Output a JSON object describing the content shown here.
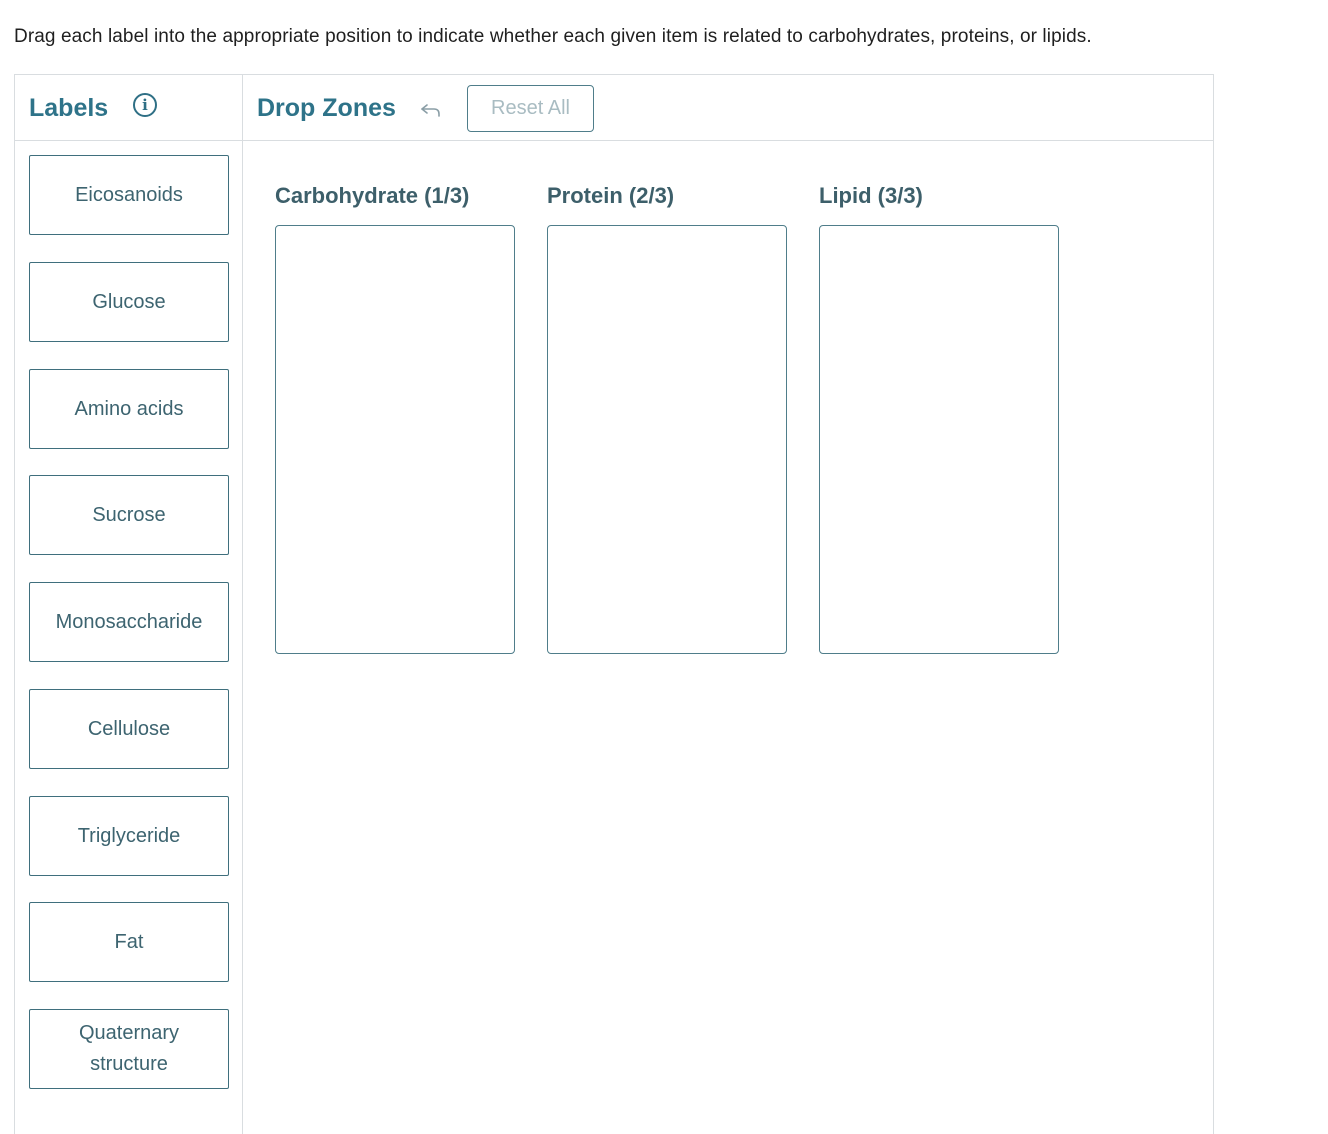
{
  "instructions": "Drag each label into the appropriate position to indicate whether each given item is related to carbohydrates, proteins, or lipids.",
  "labels_panel": {
    "title": "Labels",
    "info_icon": "info-icon",
    "items": [
      {
        "label": "Eicosanoids"
      },
      {
        "label": "Glucose"
      },
      {
        "label": "Amino acids"
      },
      {
        "label": "Sucrose"
      },
      {
        "label": "Monosaccharide"
      },
      {
        "label": "Cellulose"
      },
      {
        "label": "Triglyceride"
      },
      {
        "label": "Fat"
      },
      {
        "label": "Quaternary structure"
      }
    ]
  },
  "drop_panel": {
    "title": "Drop Zones",
    "undo_icon": "undo-arrow-icon",
    "reset_label": "Reset All",
    "zones": [
      {
        "title": "Carbohydrate (1/3)"
      },
      {
        "title": "Protein (2/3)"
      },
      {
        "title": "Lipid (3/3)"
      }
    ]
  },
  "colors": {
    "heading_teal": "#2e7389",
    "zone_title": "#3d5f6a",
    "chip_border": "#3f6f7d",
    "chip_text": "#3d6470",
    "panel_border": "#d9dde0",
    "reset_text_disabled": "#a9bcc2"
  }
}
